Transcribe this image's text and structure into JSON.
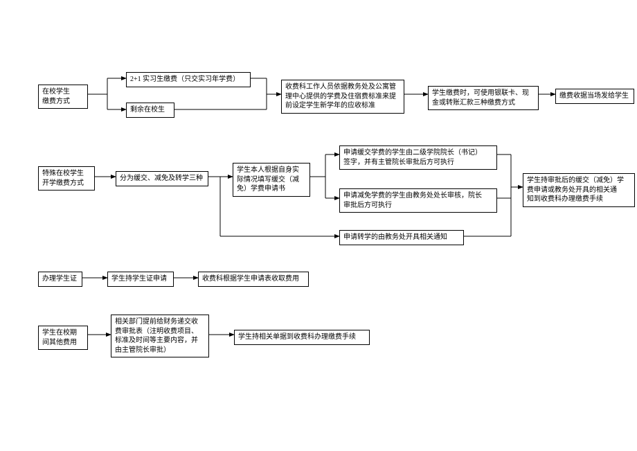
{
  "row1": {
    "start": "在校学生\n缴费方式",
    "topBranch": "2+1 实习生缴费（只交实习年学费）",
    "botBranch": "剩余在校生",
    "mid": "收费科工作人员依据教务处及公寓管\n理中心提供的学费及住宿费标准来提\n前设定学生新学年的应收标准",
    "pay": "学生缴费时，可使用银联卡、现\n金或转账汇款三种缴费方式",
    "end": "缴费收据当场发给学生"
  },
  "row2": {
    "start": "特殊在校学生\n开学缴费方式",
    "types": "分为缓交、减免及转学三种",
    "apply": "学生本人根据自身实\n际情况填写缓交（减\n免）学费申请书",
    "defer": "申请缓交学费的学生由二级学院院长（书记）\n签字，并有主管院长审批后方可执行",
    "waive": "申请减免学费的学生由教务处处长审核，院长\n审批后方可执行",
    "transfer": "申请转学的由教务处开具相关通知",
    "end": "学生持审批后的缓交（减免）学\n费申请或教务处开具的相关通\n知到收费科办理缴费手续"
  },
  "row3": {
    "start": "办理学生证",
    "apply": "学生持学生证申请",
    "charge": "收费科根据学生申请表收取费用"
  },
  "row4": {
    "start": "学生在校期\n间其他费用",
    "mid": "相关部门提前给财务递交收\n费审批表（注明收费项目、\n标准及时间等主要内容，并\n由主管院长审批）",
    "end": "学生持相关单据到收费科办理缴费手续"
  }
}
